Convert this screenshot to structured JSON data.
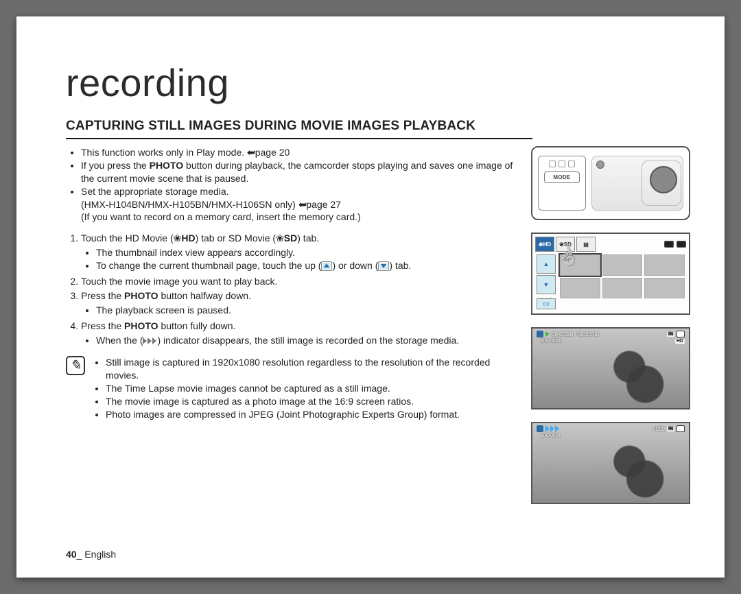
{
  "section_title": "recording",
  "heading": "CAPTURING STILL IMAGES DURING MOVIE IMAGES PLAYBACK",
  "intro_bullets": {
    "b1_a": "This function works only in Play mode. ",
    "b1_b": "page 20",
    "b2_a": "If you press the ",
    "b2_photo": "PHOTO",
    "b2_b": " button during playback, the camcorder stops playing and saves one image of the current movie scene that is paused.",
    "b3_a": "Set the appropriate storage media.",
    "b3_line2_a": "(HMX-H104BN/HMX-H105BN/HMX-H106SN only) ",
    "b3_line2_b": "page 27",
    "b3_line3": "(If you want to record on a memory card, insert the memory card.)"
  },
  "steps": {
    "s1_a": "Touch the HD Movie (",
    "s1_hd": "HD",
    "s1_b": ") tab or SD Movie (",
    "s1_sd": "SD",
    "s1_c": ") tab.",
    "s1_sub1": "The thumbnail index view appears accordingly.",
    "s1_sub2_a": "To change the current thumbnail page, touch the up (",
    "s1_sub2_b": ") or down (",
    "s1_sub2_c": ") tab.",
    "s2": "Touch the movie image you want to play back.",
    "s3_a": "Press the ",
    "s3_photo": "PHOTO",
    "s3_b": " button halfway down.",
    "s3_sub1": "The playback screen is paused.",
    "s4_a": "Press the ",
    "s4_photo": "PHOTO",
    "s4_b": " button fully down.",
    "s4_sub1_a": "When the (",
    "s4_sub1_b": ") indicator disappears, the still image is recorded on the storage media."
  },
  "notes": {
    "n1": "Still image is captured in 1920x1080 resolution regardless to the resolution of the recorded movies.",
    "n2": "The Time Lapse movie images cannot be captured as a still image.",
    "n3": "The movie image is captured as a photo image at the 16:9 screen ratios.",
    "n4": "Photo images are compressed in JPEG (Joint Photographic Experts Group) format."
  },
  "figures": {
    "cam": {
      "mode_label": "MODE"
    },
    "thumb": {
      "tab_hd": "HD",
      "tab_sd": "SD",
      "counter": "1 / 2"
    },
    "playback1": {
      "time": "00:00:20 / 00:30:00",
      "folder": "100-0001",
      "in_badge": "IN",
      "hd_badge": "HD"
    },
    "playback2": {
      "count": "9999",
      "folder": "100-0001",
      "in_badge": "IN"
    }
  },
  "footer": {
    "page_number": "40",
    "sep": "_ ",
    "language": "English"
  }
}
